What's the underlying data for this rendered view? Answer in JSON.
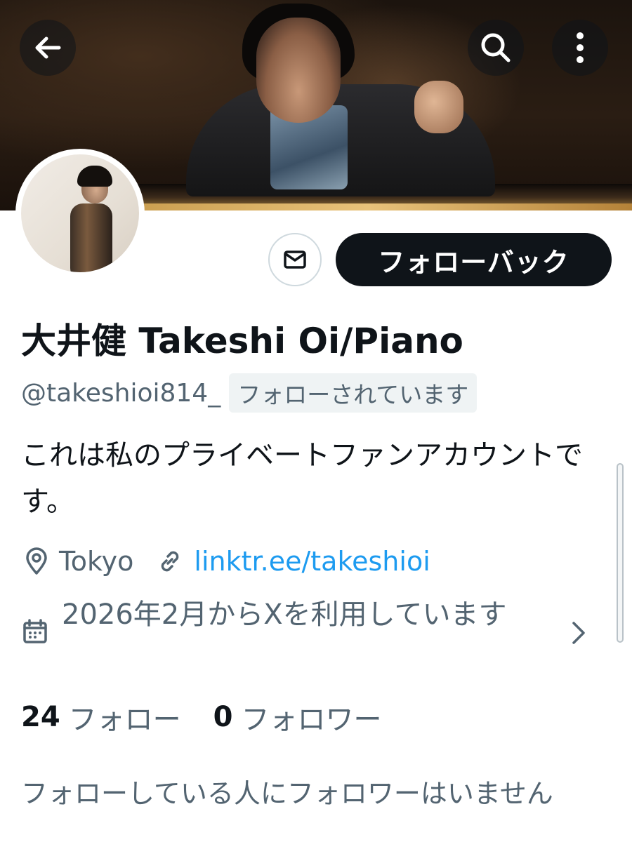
{
  "profile": {
    "display_name": "大井健 Takeshi Oi/Piano",
    "handle": "@takeshioi814_",
    "follows_you_badge": "フォローされています",
    "bio": "これは私のプライベートファンアカウントです。",
    "location": "Tokyo",
    "website": "linktr.ee/takeshioi",
    "joined": "2026年2月からXを利用しています",
    "following_count": "24",
    "following_label": "フォロー",
    "followers_count": "0",
    "followers_label": "フォロワー",
    "followers_you_know": "フォローしている人にフォロワーはいません"
  },
  "actions": {
    "follow_back_label": "フォローバック"
  },
  "icons": {
    "back": "arrow-left-icon",
    "search": "search-icon",
    "more": "more-vertical-icon",
    "message": "envelope-icon",
    "location": "location-pin-icon",
    "link": "link-icon",
    "calendar": "calendar-icon",
    "chevron": "chevron-right-icon"
  },
  "colors": {
    "text_primary": "#0f1419",
    "text_secondary": "#536471",
    "link": "#1d9bf0",
    "button_dark": "#0f1419"
  }
}
